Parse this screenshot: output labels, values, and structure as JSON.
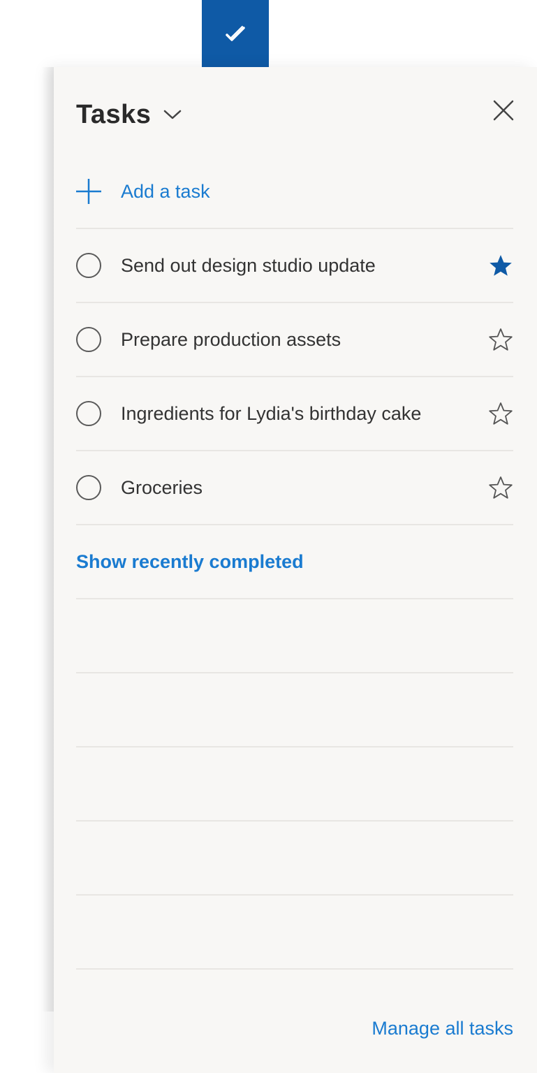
{
  "app": {
    "tab_icon": "checkmark-icon",
    "accent_color": "#0f5aa6",
    "link_color": "#1a7bd0"
  },
  "panel": {
    "title": "Tasks",
    "add_task_label": "Add a task",
    "show_completed_label": "Show recently completed",
    "manage_label": "Manage all tasks"
  },
  "tasks": [
    {
      "text": "Send out design studio update",
      "starred": true
    },
    {
      "text": "Prepare production assets",
      "starred": false
    },
    {
      "text": "Ingredients for Lydia's birthday cake",
      "starred": false
    },
    {
      "text": "Groceries",
      "starred": false
    }
  ]
}
